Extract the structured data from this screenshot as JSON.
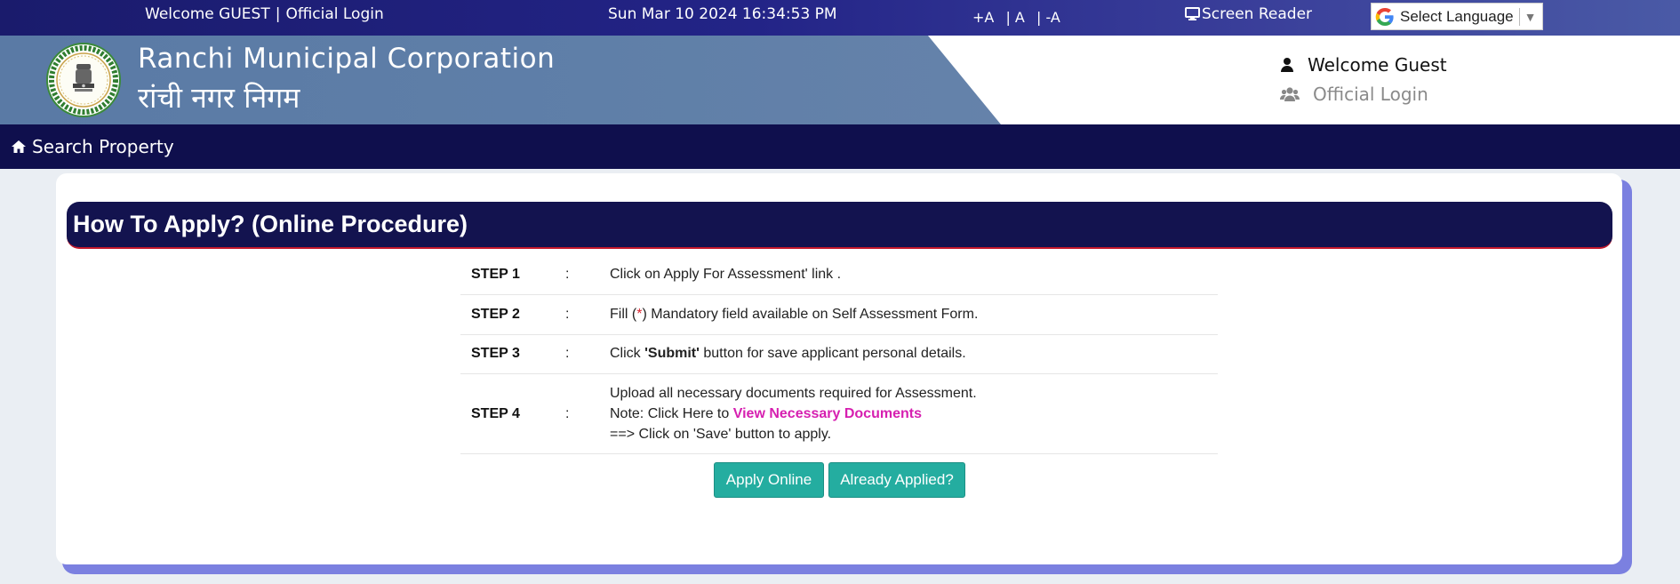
{
  "topbar": {
    "welcome": "Welcome GUEST",
    "separator": "|",
    "official_login": "Official Login",
    "datetime": "Sun Mar 10 2024 16:34:53 PM",
    "font_increase": "+A",
    "font_normal": "| A",
    "font_decrease": "| -A",
    "screen_reader": "Screen Reader",
    "language": "Select Language",
    "language_arrow": "▼"
  },
  "header": {
    "org_name_en": "Ranchi Municipal Corporation",
    "org_name_hi": "रांची नगर निगम",
    "welcome_guest": "Welcome Guest",
    "official_login": "Official Login"
  },
  "nav": {
    "search_property": "Search Property"
  },
  "content": {
    "title": "How To Apply? (Online Procedure)",
    "colon": ":",
    "steps": [
      {
        "label": "STEP 1",
        "text": "Click on Apply For Assessment' link ."
      },
      {
        "label": "STEP 2",
        "text_pre": "Fill (",
        "asterisk": "*",
        "text_post": ") Mandatory field available on Self Assessment Form."
      },
      {
        "label": "STEP 3",
        "text_pre": "Click ",
        "bold": "'Submit'",
        "text_post": " button for save applicant personal details."
      },
      {
        "label": "STEP 4",
        "line1": "Upload all necessary documents required for Assessment.",
        "line2_pre": "Note: Click Here to ",
        "line2_link": "View Necessary Documents",
        "line3": "==> Click on 'Save' button to apply."
      }
    ],
    "apply_online": "Apply Online",
    "already_applied": "Already Applied?"
  },
  "colors": {
    "topbar": "#1a1b6c",
    "header_band": "#5f7fa8",
    "nav": "#0f0f4d",
    "banner": "#13134f",
    "button": "#24ada0",
    "link": "#d61fb0",
    "card_shadow": "#7b80e0"
  },
  "icons": {
    "screen_reader": "monitor-icon",
    "language": "google-icon",
    "welcome": "user-icon",
    "official_login": "users-icon",
    "search_property": "home-icon"
  }
}
